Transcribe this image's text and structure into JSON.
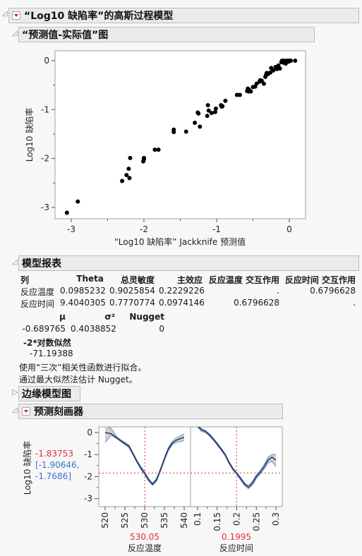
{
  "report": {
    "title": "“Log10 缺陷率”的高斯过程模型",
    "sections": {
      "actual_by_predicted": {
        "title": "“预测值-实际值”图"
      },
      "model_report": {
        "title": "模型报表"
      },
      "marginal_plots": {
        "title": "边缘模型图"
      },
      "profiler": {
        "title": "预测刻画器"
      }
    }
  },
  "model_report": {
    "columns": [
      "列",
      "Theta",
      "总灵敏度",
      "主效应",
      "反应温度 交互作用",
      "反应时间 交互作用"
    ],
    "rows": [
      [
        "反应温度",
        "0.0985232",
        "0.9025854",
        "0.2229226",
        ".",
        "0.6796628"
      ],
      [
        "反应时间",
        "9.4040305",
        "0.7770774",
        "0.0974146",
        "0.6796628",
        "."
      ]
    ],
    "params_headers": [
      "μ",
      "σ²",
      "Nugget"
    ],
    "params_values": [
      "-0.689765",
      "0.4038852",
      "0"
    ],
    "loglik_label": "-2*对数似然",
    "loglik_value": "-71.19388",
    "note1": "使用“三次”相关性函数进行拟合。",
    "note2": "通过最大似然法估计 Nugget。"
  },
  "chart_data": [
    {
      "type": "scatter",
      "title": "“预测值-实际值”图",
      "xlabel": "“Log10 缺陷率” Jackknife 预测值",
      "ylabel": "Log10 缺陷率",
      "xlim": [
        -3.25,
        0.2
      ],
      "ylim": [
        -3.25,
        0.2
      ],
      "xticks": [
        "-3",
        "-2",
        "-1",
        "0"
      ],
      "yticks": [
        "0",
        "-1",
        "-2",
        "-3"
      ],
      "grid": false,
      "points": [
        [
          -3.06,
          -3.11
        ],
        [
          -2.91,
          -2.88
        ],
        [
          -2.3,
          -2.46
        ],
        [
          -2.24,
          -2.34
        ],
        [
          -2.21,
          -2.21
        ],
        [
          -2.2,
          -2.4
        ],
        [
          -2.19,
          -1.99
        ],
        [
          -2.01,
          -2.06
        ],
        [
          -2.0,
          -2.02
        ],
        [
          -2.0,
          -1.99
        ],
        [
          -1.85,
          -1.82
        ],
        [
          -1.8,
          -1.82
        ],
        [
          -1.59,
          -1.41
        ],
        [
          -1.59,
          -1.46
        ],
        [
          -1.42,
          -1.45
        ],
        [
          -1.3,
          -1.27
        ],
        [
          -1.26,
          -1.06
        ],
        [
          -1.25,
          -1.08
        ],
        [
          -1.23,
          -1.35
        ],
        [
          -1.13,
          -1.13
        ],
        [
          -1.12,
          -0.91
        ],
        [
          -1.11,
          -1.02
        ],
        [
          -1.07,
          -1.07
        ],
        [
          -1.02,
          -1.05
        ],
        [
          -1.01,
          -0.98
        ],
        [
          -0.94,
          -0.91
        ],
        [
          -0.93,
          -0.94
        ],
        [
          -0.92,
          -0.93
        ],
        [
          -0.88,
          -0.82
        ],
        [
          -0.72,
          -0.7
        ],
        [
          -0.68,
          -0.7
        ],
        [
          -0.58,
          -0.62
        ],
        [
          -0.57,
          -0.57
        ],
        [
          -0.56,
          -0.63
        ],
        [
          -0.55,
          -0.6
        ],
        [
          -0.53,
          -0.63
        ],
        [
          -0.5,
          -0.54
        ],
        [
          -0.47,
          -0.53
        ],
        [
          -0.45,
          -0.47
        ],
        [
          -0.41,
          -0.43
        ],
        [
          -0.4,
          -0.4
        ],
        [
          -0.38,
          -0.41
        ],
        [
          -0.35,
          -0.47
        ],
        [
          -0.33,
          -0.33
        ],
        [
          -0.32,
          -0.29
        ],
        [
          -0.31,
          -0.25
        ],
        [
          -0.29,
          -0.27
        ],
        [
          -0.26,
          -0.24
        ],
        [
          -0.25,
          -0.15
        ],
        [
          -0.22,
          -0.2
        ],
        [
          -0.19,
          -0.13
        ],
        [
          -0.17,
          -0.17
        ],
        [
          -0.15,
          -0.1
        ],
        [
          -0.13,
          -0.16
        ],
        [
          -0.11,
          -0.03
        ],
        [
          -0.1,
          0.0
        ],
        [
          -0.08,
          -0.04
        ],
        [
          -0.07,
          0.0
        ],
        [
          -0.05,
          -0.06
        ],
        [
          -0.04,
          -0.01
        ],
        [
          -0.03,
          0.0
        ],
        [
          -0.01,
          -0.02
        ],
        [
          0.0,
          0.0
        ],
        [
          0.02,
          0.0
        ],
        [
          0.08,
          0.0
        ]
      ]
    },
    {
      "type": "line",
      "title": "预测刻画器",
      "ylabel": "Log10 缺陷率",
      "ylim": [
        -3.4,
        0.3
      ],
      "yticks": [
        "0",
        "-1",
        "-2",
        "-3"
      ],
      "predicted_value": "-1.83753",
      "ci_text_1": "[-1.90646,",
      "ci_text_2": "-1.7686]",
      "panels": [
        {
          "xlabel": "反应温度",
          "current_x": "530.05",
          "xlim": [
            519,
            541.5
          ],
          "xticks": [
            "520",
            "525",
            "530",
            "535",
            "540"
          ],
          "x": [
            520,
            521.5,
            523,
            524,
            525,
            526,
            527,
            528,
            529,
            530,
            531,
            532,
            533,
            534,
            535,
            536,
            537,
            538,
            539,
            540
          ],
          "y": [
            0.0,
            -0.05,
            -0.25,
            -0.38,
            -0.5,
            -0.62,
            -0.95,
            -1.3,
            -1.6,
            -1.86,
            -2.15,
            -2.35,
            -2.15,
            -1.7,
            -1.2,
            -0.75,
            -0.48,
            -0.35,
            -0.28,
            -0.22
          ],
          "lower": [
            -0.45,
            -0.12,
            -0.28,
            -0.42,
            -0.55,
            -0.68,
            -1.0,
            -1.35,
            -1.66,
            -1.91,
            -2.21,
            -2.4,
            -2.21,
            -1.76,
            -1.26,
            -0.82,
            -0.56,
            -0.45,
            -0.4,
            -0.38
          ],
          "upper": [
            0.35,
            0.18,
            -0.2,
            -0.34,
            -0.45,
            -0.56,
            -0.9,
            -1.25,
            -1.54,
            -1.77,
            -2.09,
            -2.3,
            -2.09,
            -1.64,
            -1.14,
            -0.68,
            -0.4,
            -0.25,
            -0.16,
            -0.06
          ]
        },
        {
          "xlabel": "反应时间",
          "current_x": "0.1995",
          "xlim": [
            0.0825,
            0.3075
          ],
          "xticks": [
            "0.1",
            "0.15",
            "0.2",
            "0.25",
            "0.3"
          ],
          "x": [
            0.1,
            0.11,
            0.12,
            0.13,
            0.14,
            0.15,
            0.16,
            0.17,
            0.18,
            0.19,
            0.2,
            0.21,
            0.22,
            0.23,
            0.24,
            0.25,
            0.26,
            0.27,
            0.28,
            0.29,
            0.3
          ],
          "y": [
            0.3,
            0.12,
            0.05,
            -0.1,
            -0.3,
            -0.52,
            -0.75,
            -1.0,
            -1.35,
            -1.65,
            -1.86,
            -2.1,
            -2.35,
            -2.48,
            -2.3,
            -2.0,
            -1.8,
            -1.55,
            -1.25,
            -1.12,
            -1.25
          ],
          "lower": [
            0.25,
            0.05,
            0.0,
            -0.15,
            -0.35,
            -0.57,
            -0.8,
            -1.05,
            -1.4,
            -1.7,
            -1.91,
            -2.16,
            -2.41,
            -2.55,
            -2.38,
            -2.08,
            -1.88,
            -1.65,
            -1.38,
            -1.3,
            -1.55
          ],
          "upper": [
            0.38,
            0.18,
            0.1,
            -0.05,
            -0.25,
            -0.47,
            -0.7,
            -0.95,
            -1.3,
            -1.6,
            -1.81,
            -2.04,
            -2.29,
            -2.41,
            -2.22,
            -1.92,
            -1.72,
            -1.45,
            -1.12,
            -1.0,
            -1.0
          ]
        }
      ]
    }
  ],
  "colors": {
    "accent_red": "#e0303e",
    "ci_blue": "#3d6fd8",
    "header_bg": "#ebebeb",
    "point": "#000000"
  }
}
